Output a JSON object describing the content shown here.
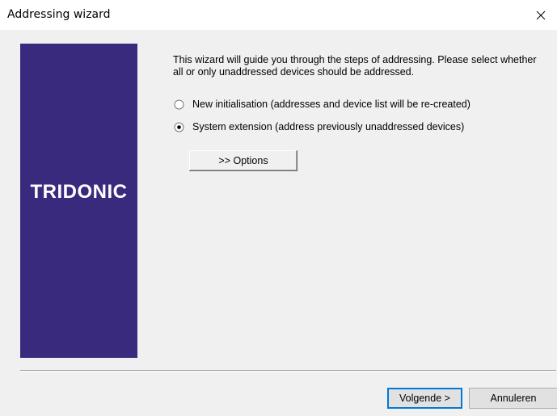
{
  "window": {
    "title": "Addressing wizard",
    "close_icon": "close-icon"
  },
  "banner": {
    "logo_text": "TRIDONIC",
    "color": "#3a2a7e"
  },
  "content": {
    "intro": "This wizard will guide you through the steps of addressing. Please select whether all or only unaddressed devices should be addressed.",
    "options": [
      {
        "label": "New initialisation (addresses and device list will be re-created)",
        "selected": false
      },
      {
        "label": "System extension (address previously unaddressed devices)",
        "selected": true
      }
    ],
    "options_button_label": ">> Options"
  },
  "footer": {
    "next_label": "Volgende >",
    "cancel_label": "Annuleren"
  },
  "colors": {
    "accent": "#0078d7",
    "dialog_bg": "#f0f0f0"
  }
}
